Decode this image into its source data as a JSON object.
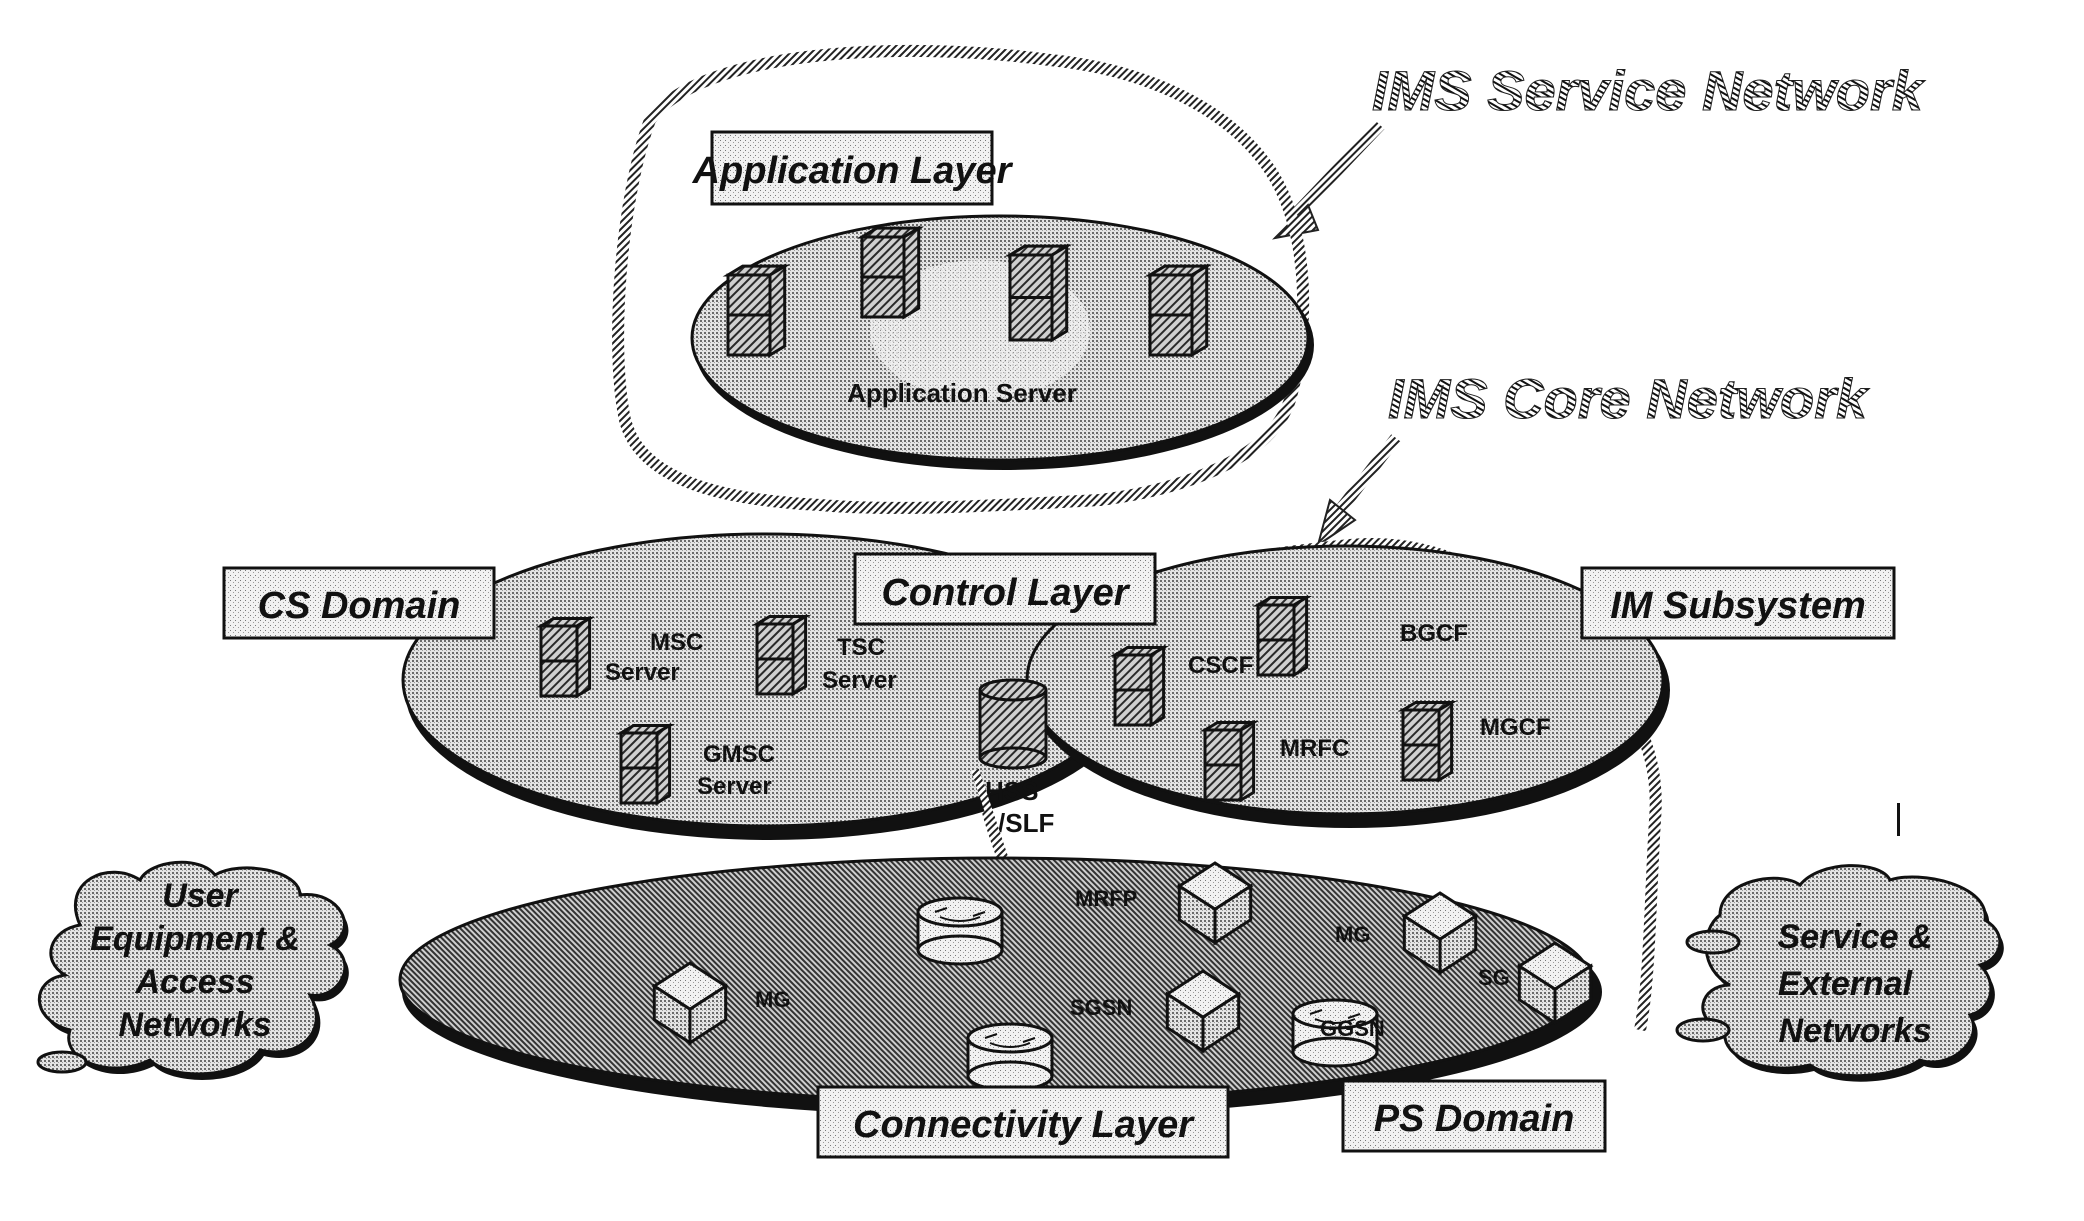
{
  "titles": {
    "service_network": "IMS Service Network",
    "core_network": "IMS Core Network"
  },
  "layers": {
    "application": "Application Layer",
    "control": "Control Layer",
    "connectivity": "Connectivity Layer"
  },
  "domains": {
    "cs": "CS Domain",
    "im": "IM Subsystem",
    "ps": "PS Domain"
  },
  "application_layer": {
    "server_label": "Application Server"
  },
  "cs_domain": {
    "nodes": [
      {
        "line1": "MSC",
        "line2": "Server"
      },
      {
        "line1": "TSC",
        "line2": "Server"
      },
      {
        "line1": "GMSC",
        "line2": "Server"
      }
    ]
  },
  "hss": {
    "line1": "HSS",
    "line2": "/SLF"
  },
  "im_subsystem": {
    "nodes": [
      "CSCF",
      "BGCF",
      "MRFC",
      "MGCF"
    ]
  },
  "connectivity_layer": {
    "nodes": [
      "MRFP",
      "MG",
      "SGSN",
      "MG",
      "SG",
      "GGSN"
    ]
  },
  "clouds": {
    "user": [
      "User",
      "Equipment &",
      "Access",
      "Networks"
    ],
    "service": [
      "Service &",
      "External",
      "Networks"
    ]
  },
  "colors": {
    "ink": "#111111",
    "fill_light": "#d9d9d9",
    "fill_mid": "#bdbdbd",
    "fill_dark": "#8c8c8c"
  }
}
